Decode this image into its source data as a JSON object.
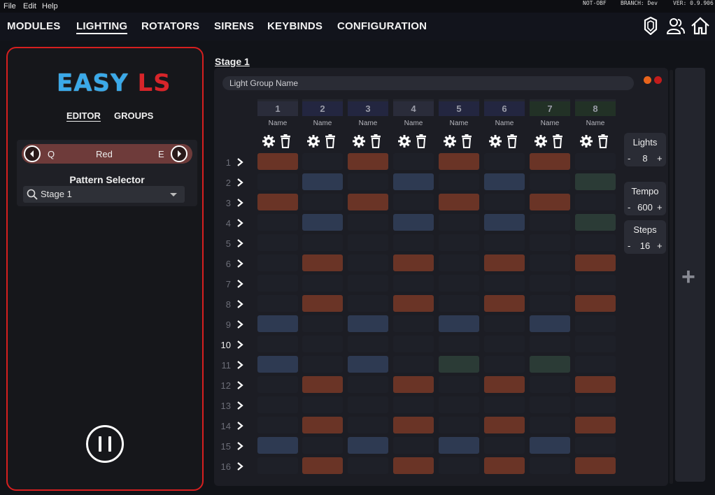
{
  "menubar": {
    "items": [
      "File",
      "Edit",
      "Help"
    ],
    "info": {
      "build": "NOT-OBF",
      "branch": "BRANCH: Dev",
      "version": "VER: 0.9.906"
    }
  },
  "nav": {
    "tabs": [
      "MODULES",
      "LIGHTING",
      "ROTATORS",
      "SIRENS",
      "KEYBINDS",
      "CONFIGURATION"
    ],
    "active": "LIGHTING"
  },
  "left": {
    "logo": {
      "part1": "EASY",
      "part2": "LS"
    },
    "tabs": [
      "EDITOR",
      "GROUPS"
    ],
    "color_selector": {
      "prev_key": "Q",
      "color": "Red",
      "next_key": "E"
    },
    "pattern_selector": {
      "title": "Pattern Selector",
      "value": "Stage 1"
    }
  },
  "main": {
    "stage_tab": "Stage 1",
    "group_name_placeholder": "Light Group Name",
    "columns": [
      {
        "num": "1",
        "name": "Name"
      },
      {
        "num": "2",
        "name": "Name"
      },
      {
        "num": "3",
        "name": "Name"
      },
      {
        "num": "4",
        "name": "Name"
      },
      {
        "num": "5",
        "name": "Name"
      },
      {
        "num": "6",
        "name": "Name"
      },
      {
        "num": "7",
        "name": "Name"
      },
      {
        "num": "8",
        "name": "Name"
      }
    ],
    "rows": [
      "1",
      "2",
      "3",
      "4",
      "5",
      "6",
      "7",
      "8",
      "9",
      "10",
      "11",
      "12",
      "13",
      "14",
      "15",
      "16"
    ],
    "active_row": "10",
    "grid": [
      [
        "r",
        "",
        "r",
        "",
        "r",
        "",
        "r",
        ""
      ],
      [
        "",
        "b",
        "",
        "b",
        "",
        "b",
        "",
        "g"
      ],
      [
        "r",
        "",
        "r",
        "",
        "r",
        "",
        "r",
        ""
      ],
      [
        "",
        "b",
        "",
        "b",
        "",
        "b",
        "",
        "g"
      ],
      [
        "",
        "",
        "",
        "",
        "",
        "",
        "",
        ""
      ],
      [
        "",
        "r",
        "",
        "r",
        "",
        "r",
        "",
        "r"
      ],
      [
        "",
        "",
        "",
        "",
        "",
        "",
        "",
        ""
      ],
      [
        "",
        "r",
        "",
        "r",
        "",
        "r",
        "",
        "r"
      ],
      [
        "b",
        "",
        "b",
        "",
        "b",
        "",
        "b",
        ""
      ],
      [
        "",
        "",
        "",
        "",
        "",
        "",
        "",
        ""
      ],
      [
        "b",
        "",
        "b",
        "",
        "g",
        "",
        "g",
        ""
      ],
      [
        "",
        "r",
        "",
        "r",
        "",
        "r",
        "",
        "r"
      ],
      [
        "",
        "",
        "",
        "",
        "",
        "",
        "",
        ""
      ],
      [
        "",
        "r",
        "",
        "r",
        "",
        "r",
        "",
        "r"
      ],
      [
        "b",
        "",
        "b",
        "",
        "b",
        "",
        "b",
        ""
      ],
      [
        "",
        "r",
        "",
        "r",
        "",
        "r",
        "",
        "r"
      ]
    ],
    "header_tints": [
      "#2a2c3a",
      "#232640",
      "#232640",
      "#2a2c3a",
      "#232640",
      "#232640",
      "#223126",
      "#223126"
    ],
    "colors": {
      "r": "#6a3426",
      "b": "#2e3a52",
      "g": "#2b3b36"
    },
    "lights": {
      "label": "Lights",
      "value": "8"
    },
    "tempo": {
      "label": "Tempo",
      "value": "600"
    },
    "steps": {
      "label": "Steps",
      "value": "16"
    },
    "minus": "-",
    "plus": "+",
    "add_symbol": "+"
  }
}
